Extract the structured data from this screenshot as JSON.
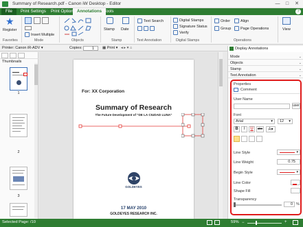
{
  "window": {
    "title": "Summary of Research.pdf - Canon iW Desktop - Editor",
    "minimize": "—",
    "maximize": "□",
    "close": "✕"
  },
  "ribbon_tabs": [
    "File",
    "Print Settings",
    "Print Option",
    "Annotations",
    "Tools"
  ],
  "help": "?",
  "ribbon": {
    "register": "Register",
    "insert_multiple": "Insert Multiple",
    "stamp": "Stamp",
    "date": "Date",
    "text_search": "Text Search",
    "digital_stamps": "Digital Stamps",
    "signature_status": "Signature Status",
    "verify": "Verify",
    "order": "Order",
    "group": "Group",
    "align": "Align",
    "page_operations": "Page Operations",
    "view": "View",
    "groups": {
      "favorites": "Favorites",
      "mode": "Mode",
      "objects": "Objects",
      "stamp": "Stamp",
      "text_annotation": "Text Annotation",
      "digital_stamps": "Digital Stamps",
      "operations": "Operations"
    }
  },
  "toolbar": {
    "printer_label": "Printer: Canon iR-ADV",
    "copies_label": "Copies:",
    "copies_value": "1",
    "print_label": "Print",
    "display_annotations": "Display Annotations"
  },
  "left_panel": {
    "title": "Thumbnails",
    "page_numbers": [
      "1",
      "2",
      "3"
    ]
  },
  "document": {
    "corporation": "For: XX Corporation",
    "title": "Summary of Research",
    "subtitle": "The Future Development of \"DE LA CIUDAD LUNA\"",
    "logo_text": "GOLDEYES",
    "date": "17 MAY 2010",
    "company": "GOLDEYES RESEARCH INC."
  },
  "right_panel": {
    "sections": [
      "Mode",
      "Objects",
      "Stamp",
      "Text Annotation"
    ],
    "properties": {
      "title": "Properties",
      "comment": "Comment",
      "user_name_label": "User Name",
      "user_button": "user",
      "font_label": "Font",
      "font_value": "Arial",
      "font_size": "12",
      "bold": "B",
      "italic": "I",
      "underline": "U",
      "strike": "abc",
      "line_style": "Line Style",
      "line_weight": "Line Weight",
      "line_weight_value": "0.75",
      "begin_style": "Begin Style",
      "line_color": "Line Color",
      "shape_fill": "Shape Fill",
      "transparency": "Transparency",
      "transparency_value": "0",
      "percent": "%"
    }
  },
  "status": {
    "selected_page": "Selected Page: /10",
    "zoom": "59%"
  },
  "colors": {
    "green": "#2e7d32",
    "red": "#e01b1b",
    "blue_icon": "#4a78b8"
  }
}
